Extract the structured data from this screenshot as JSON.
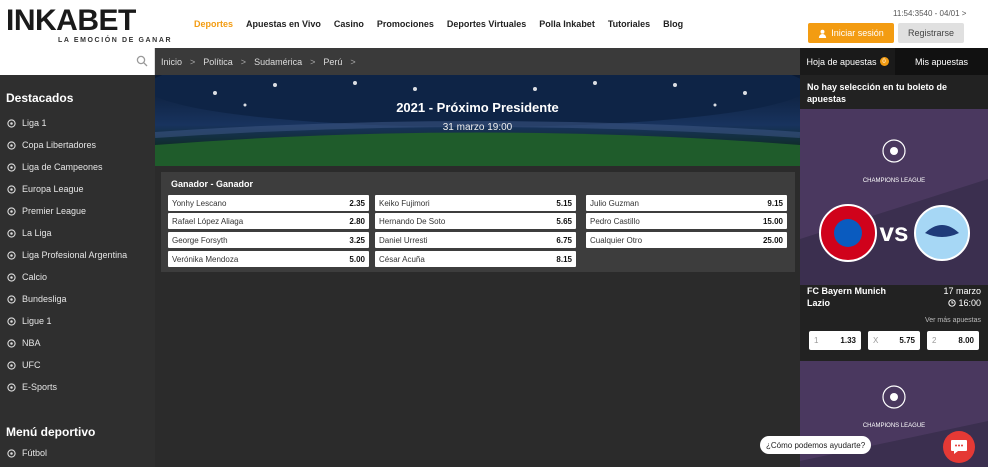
{
  "brand": {
    "logo_main": "INKABET",
    "logo_tag": "LA EMOCIÓN DE GANAR"
  },
  "header": {
    "nav": [
      "Deportes",
      "Apuestas en Vivo",
      "Casino",
      "Promociones",
      "Deportes Virtuales",
      "Polla Inkabet",
      "Tutoriales",
      "Blog"
    ],
    "active_nav": "Deportes",
    "id_text": "11:54:3540 - 04/01 >",
    "login_label": "Iniciar sesión",
    "register_label": "Registrarse"
  },
  "sidebar": {
    "search_placeholder": "",
    "destacados_title": "Destacados",
    "destacados": [
      "Liga 1",
      "Copa Libertadores",
      "Liga de Campeones",
      "Europa League",
      "Premier League",
      "La Liga",
      "Liga Profesional Argentina",
      "Calcio",
      "Bundesliga",
      "Ligue 1",
      "NBA",
      "UFC",
      "E-Sports"
    ],
    "menu_title": "Menú deportivo",
    "menu": [
      "Fútbol"
    ]
  },
  "breadcrumb": [
    "Inicio",
    "Política",
    "Sudamérica",
    "Perú"
  ],
  "event": {
    "title": "2021 - Próximo Presidente",
    "date": "31 marzo 19:00"
  },
  "market": {
    "title": "Ganador - Ganador",
    "odds": [
      {
        "name": "Yonhy Lescano",
        "value": "2.35"
      },
      {
        "name": "Keiko Fujimori",
        "value": "5.15"
      },
      {
        "name": "Julio Guzman",
        "value": "9.15"
      },
      {
        "name": "Rafael López Aliaga",
        "value": "2.80"
      },
      {
        "name": "Hernando De Soto",
        "value": "5.65"
      },
      {
        "name": "Pedro Castillo",
        "value": "15.00"
      },
      {
        "name": "George Forsyth",
        "value": "3.25"
      },
      {
        "name": "Daniel Urresti",
        "value": "6.75"
      },
      {
        "name": "Cualquier Otro",
        "value": "25.00"
      },
      {
        "name": "Verónika Mendoza",
        "value": "5.00"
      },
      {
        "name": "César Acuña",
        "value": "8.15"
      }
    ]
  },
  "betslip": {
    "tab_active": "Hoja de apuestas",
    "tab_badge": "0",
    "tab_other": "Mis apuestas",
    "empty_msg": "No hay selección en tu boleto de apuestas"
  },
  "promo": {
    "competition": "CHAMPIONS LEAGUE",
    "home": "FC Bayern Munich",
    "away": "Lazio",
    "date": "17 marzo",
    "time": "16:00",
    "more": "Ver más apuestas",
    "odds": [
      {
        "key": "1",
        "value": "1.33"
      },
      {
        "key": "X",
        "value": "5.75"
      },
      {
        "key": "2",
        "value": "8.00"
      }
    ]
  },
  "chat": {
    "prompt": "¿Cómo podemos ayudarte?"
  },
  "colors": {
    "accent": "#f39c12",
    "dark": "#2b2b2b",
    "chat": "#e53935"
  }
}
